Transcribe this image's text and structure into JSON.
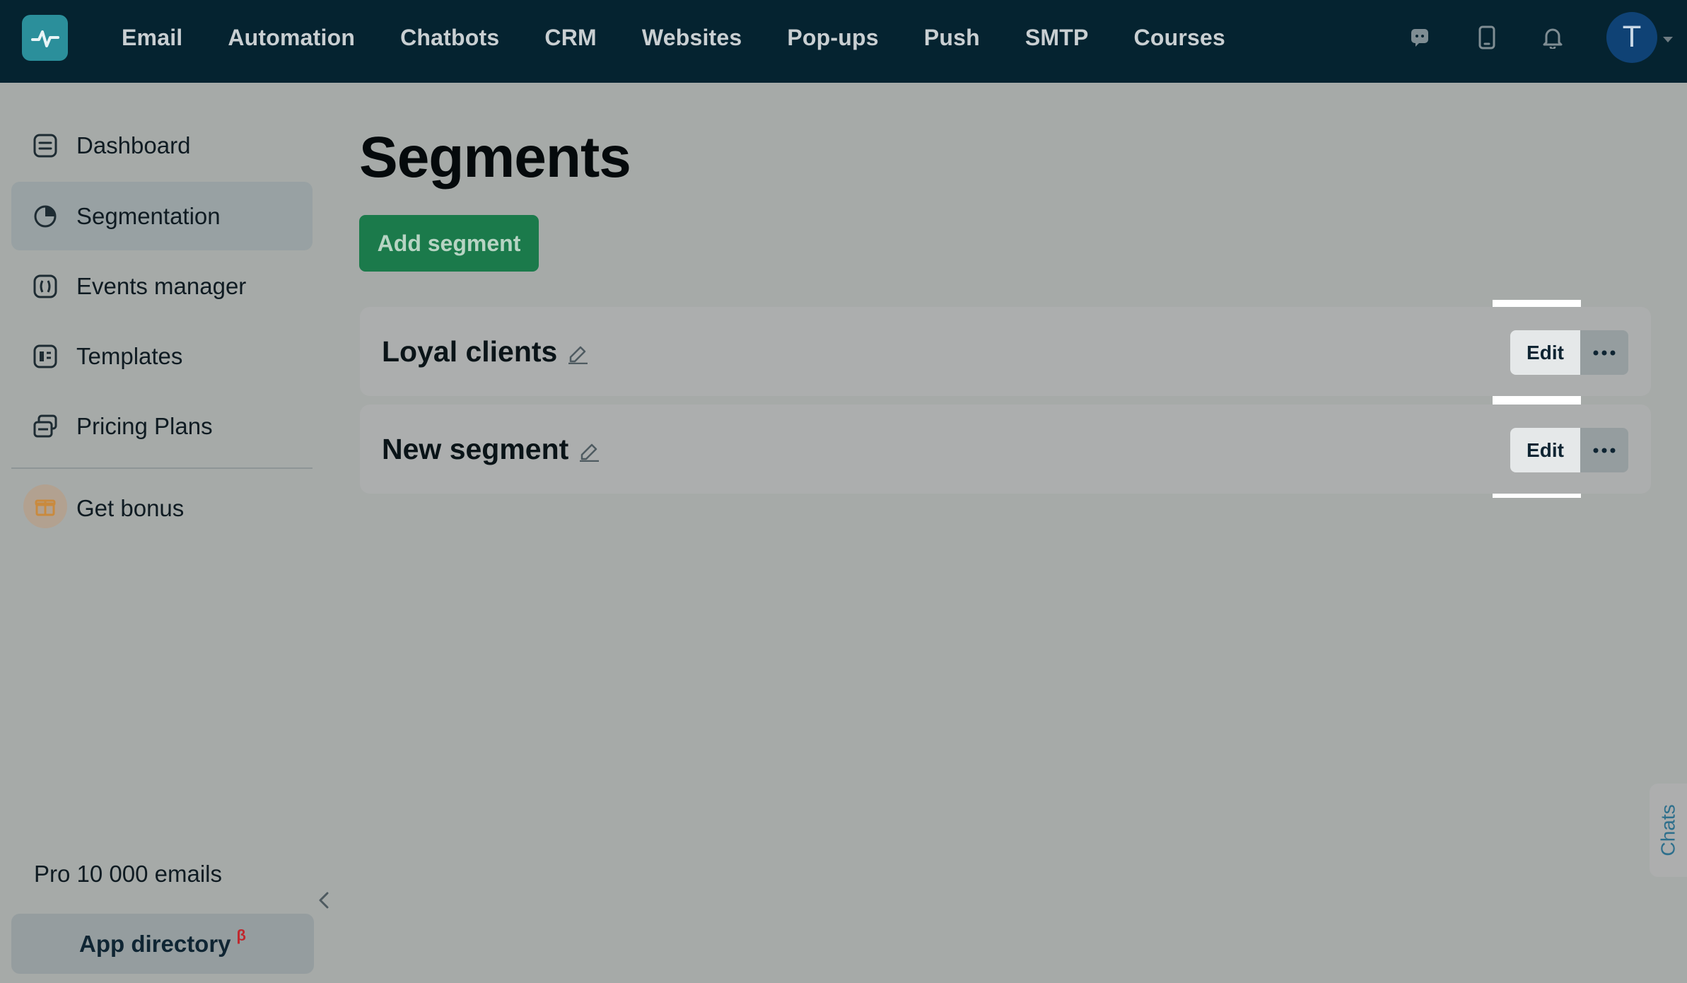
{
  "topnav": {
    "items": [
      "Email",
      "Automation",
      "Chatbots",
      "CRM",
      "Websites",
      "Pop-ups",
      "Push",
      "SMTP",
      "Courses"
    ],
    "avatar_initial": "T",
    "icons": [
      "chat-icon",
      "mobile-icon",
      "bell-icon"
    ]
  },
  "sidebar": {
    "items": [
      {
        "label": "Dashboard",
        "icon": "dashboard-icon"
      },
      {
        "label": "Segmentation",
        "icon": "segmentation-icon",
        "active": true
      },
      {
        "label": "Events manager",
        "icon": "events-icon"
      },
      {
        "label": "Templates",
        "icon": "templates-icon"
      },
      {
        "label": "Pricing Plans",
        "icon": "pricing-icon"
      }
    ],
    "bonus_label": "Get bonus",
    "plan_text": "Pro 10 000 emails",
    "app_directory_label": "App directory",
    "app_directory_badge": "β"
  },
  "main": {
    "title": "Segments",
    "add_button_label": "Add segment",
    "segments": [
      {
        "name": "Loyal clients",
        "edit_label": "Edit"
      },
      {
        "name": "New segment",
        "edit_label": "Edit"
      }
    ]
  },
  "chats_tab_label": "Chats",
  "colors": {
    "topbar": "#052330",
    "accent_green": "#1b7a4b",
    "logo": "#2b8f9b",
    "avatar": "#0f4275",
    "beta_red": "#c0282e"
  }
}
